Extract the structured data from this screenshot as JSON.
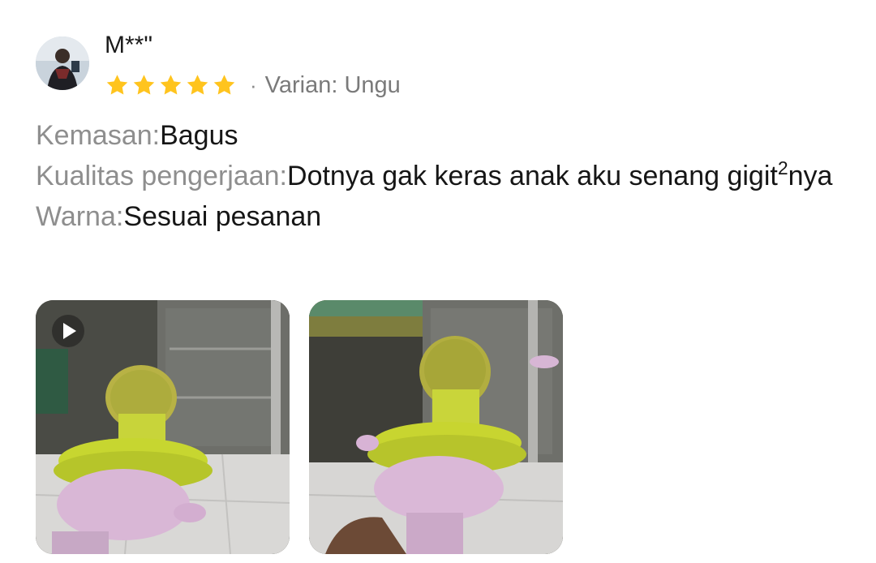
{
  "review": {
    "username": "M**\"",
    "rating": 5,
    "rating_max": 5,
    "star_color": "#FFC41E",
    "separator": "·",
    "variant": "Varian: Ungu",
    "fields": {
      "packaging_label": "Kemasan:",
      "packaging_value": "Bagus",
      "quality_label": "Kualitas pengerjaan:",
      "quality_value_pre": "Dotnya gak keras anak aku senang gigit",
      "quality_value_sup": "2",
      "quality_value_post": "nya",
      "color_label": "Warna:",
      "color_value": "Sesuai pesanan"
    },
    "media": [
      {
        "kind": "video",
        "icon": "play-icon"
      },
      {
        "kind": "image",
        "icon": "none"
      }
    ]
  }
}
